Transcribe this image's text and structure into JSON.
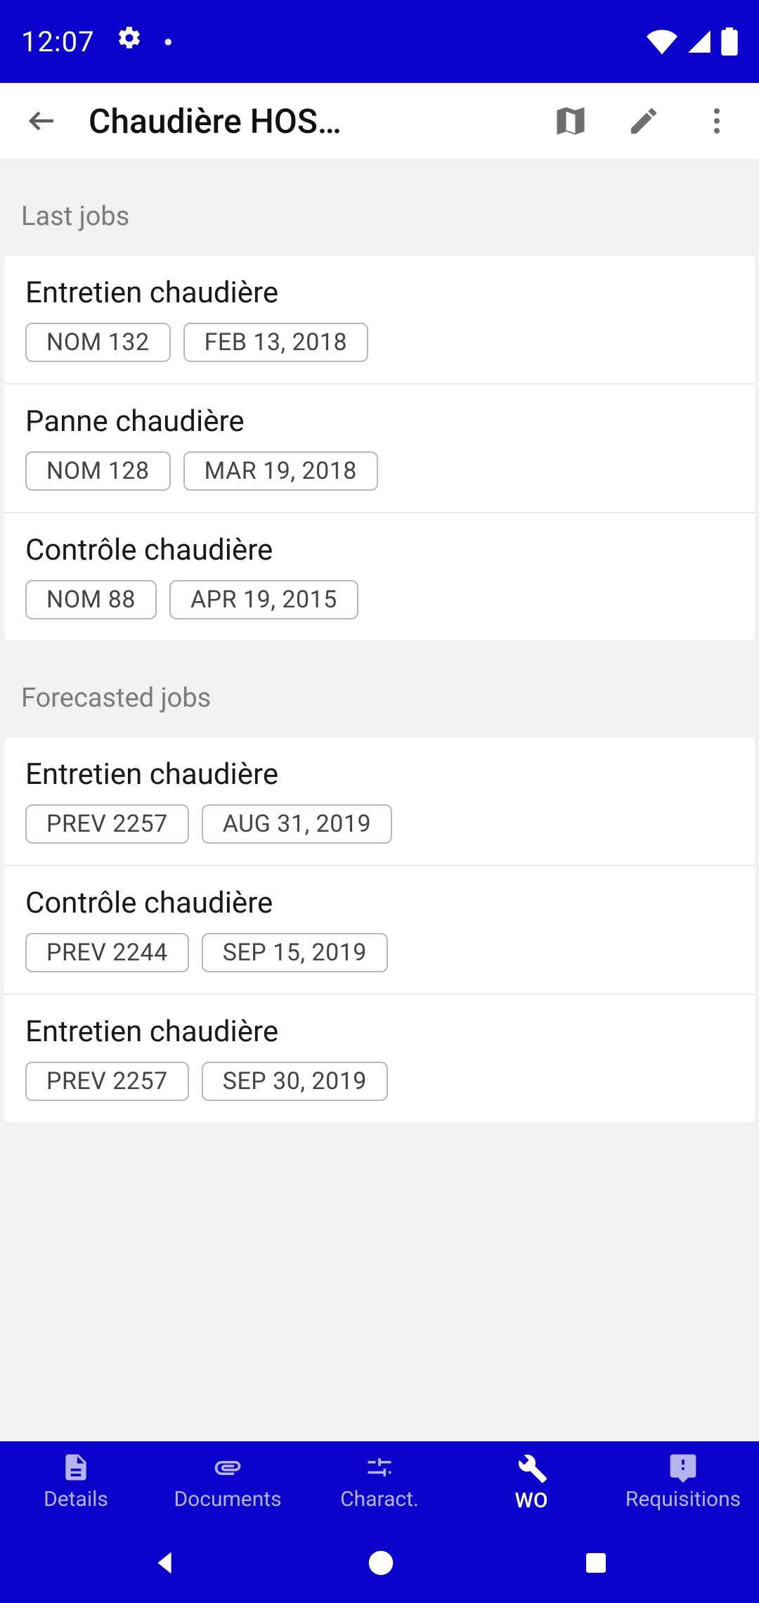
{
  "status": {
    "time": "12:07"
  },
  "header": {
    "title": "Chaudière HOS…"
  },
  "sections": {
    "last": {
      "label": "Last jobs",
      "items": [
        {
          "title": "Entretien chaudière",
          "code": "NOM 132",
          "date": "FEB 13, 2018"
        },
        {
          "title": "Panne chaudière",
          "code": "NOM 128",
          "date": "MAR 19, 2018"
        },
        {
          "title": "Contrôle chaudière",
          "code": "NOM 88",
          "date": "APR 19, 2015"
        }
      ]
    },
    "forecast": {
      "label": "Forecasted jobs",
      "items": [
        {
          "title": "Entretien chaudière",
          "code": "PREV 2257",
          "date": "AUG 31, 2019"
        },
        {
          "title": "Contrôle chaudière",
          "code": "PREV 2244",
          "date": "SEP 15, 2019"
        },
        {
          "title": "Entretien chaudière",
          "code": "PREV 2257",
          "date": "SEP 30, 2019"
        }
      ]
    }
  },
  "nav": {
    "details": "Details",
    "documents": "Documents",
    "charact": "Charact.",
    "wo": "WO",
    "requisitions": "Requisitions"
  }
}
